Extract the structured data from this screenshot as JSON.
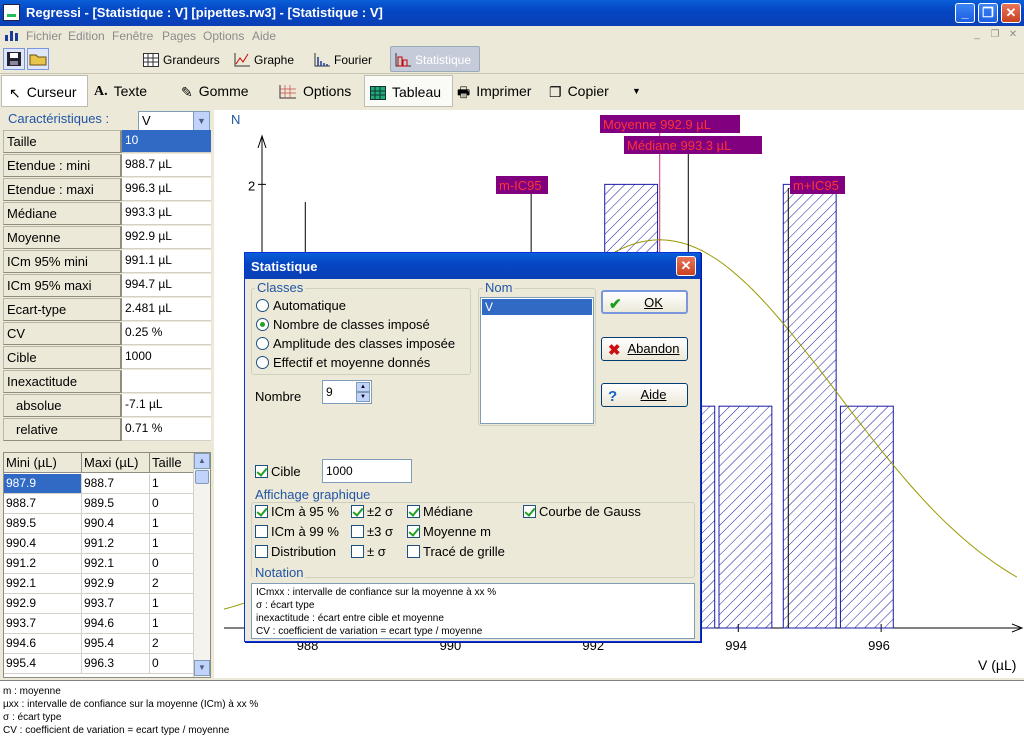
{
  "window": {
    "title": "Regressi  - [Statistique : V] [pipettes.rw3] - [Statistique : V]"
  },
  "menu": {
    "items": [
      "Fichier",
      "Edition",
      "Fenêtre",
      "Pages",
      "Options",
      "Aide"
    ]
  },
  "top_toolbar": {
    "grandeurs": "Grandeurs",
    "graphe": "Graphe",
    "fourier": "Fourier",
    "statistique": "Statistique"
  },
  "tool_toolbar": {
    "curseur": "Curseur",
    "texte": "Texte",
    "gomme": "Gomme",
    "options": "Options",
    "tableau": "Tableau",
    "imprimer": "Imprimer",
    "copier": "Copier"
  },
  "left_panel": {
    "caracteristiques_label": "Caractéristiques :",
    "selected_variable": "V",
    "stats": [
      {
        "key": "Taille",
        "value": "10"
      },
      {
        "key": "Etendue : mini",
        "value": "988.7 µL"
      },
      {
        "key": "Etendue : maxi",
        "value": "996.3 µL"
      },
      {
        "key": "Médiane",
        "value": "993.3 µL"
      },
      {
        "key": "Moyenne",
        "value": "992.9 µL"
      },
      {
        "key": "ICm 95% mini",
        "value": "991.1 µL"
      },
      {
        "key": "ICm 95% maxi",
        "value": "994.7 µL"
      },
      {
        "key": "Ecart-type",
        "value": "2.481 µL"
      },
      {
        "key": "CV",
        "value": " 0.25 %"
      },
      {
        "key": "Cible",
        "value": "1000"
      },
      {
        "key": "Inexactitude",
        "value": ""
      },
      {
        "key": "absolue",
        "value": "-7.1 µL"
      },
      {
        "key": "relative",
        "value": " 0.71 %"
      }
    ],
    "class_table": {
      "headers": [
        "Mini (µL)",
        "Maxi (µL)",
        "Taille"
      ],
      "rows": [
        [
          "987.9",
          "988.7",
          "1"
        ],
        [
          "988.7",
          "989.5",
          "0"
        ],
        [
          "989.5",
          "990.4",
          "1"
        ],
        [
          "990.4",
          "991.2",
          "1"
        ],
        [
          "991.2",
          "992.1",
          "0"
        ],
        [
          "992.1",
          "992.9",
          "2"
        ],
        [
          "992.9",
          "993.7",
          "1"
        ],
        [
          "993.7",
          "994.6",
          "1"
        ],
        [
          "994.6",
          "995.4",
          "2"
        ],
        [
          "995.4",
          "996.3",
          "0"
        ]
      ]
    }
  },
  "graph": {
    "y_label": "N",
    "x_label": "V (µL)",
    "x_ticks": [
      "988",
      "990",
      "992",
      "994",
      "996"
    ],
    "y_ticks": [
      "2",
      "1",
      "0"
    ],
    "annotations": {
      "moyenne": "Moyenne  992.9 µL",
      "mediane": "Médiane  993.3 µL",
      "icm_low": "m-IC95",
      "icm_high": "m+IC95"
    }
  },
  "chart_data": {
    "type": "bar",
    "x": [
      988.3,
      989.1,
      990.0,
      990.8,
      991.6,
      992.5,
      993.3,
      994.1,
      995.0,
      995.8
    ],
    "values": [
      1,
      0,
      1,
      1,
      0,
      2,
      1,
      1,
      2,
      1
    ],
    "xlabel": "V (µL)",
    "ylabel": "N",
    "xlim": [
      986.8,
      998.0
    ],
    "ylim": [
      0,
      2.2
    ],
    "markers": {
      "mean": 992.9,
      "median": 993.3,
      "ic95_low": 991.1,
      "ic95_high": 994.7
    },
    "gauss_curve": {
      "mean": 992.9,
      "sd": 2.481
    }
  },
  "dialog": {
    "title": "Statistique",
    "classes_group": "Classes",
    "radio_options": [
      {
        "label": "Automatique",
        "checked": false
      },
      {
        "label": "Nombre de classes imposé",
        "checked": true
      },
      {
        "label": "Amplitude des classes imposée",
        "checked": false
      },
      {
        "label": "Effectif et moyenne donnés",
        "checked": false
      }
    ],
    "nom_group": "Nom",
    "nom_items": [
      "V"
    ],
    "ok": "OK",
    "abandon": "Abandon",
    "aide": "Aide",
    "nombre_label": "Nombre",
    "nombre_value": "9",
    "cible_label": "Cible",
    "cible_value": "1000",
    "affichage_group": "Affichage graphique",
    "checks": {
      "icm95": {
        "label": "ICm à 95 %",
        "checked": true
      },
      "pm2s": {
        "label": "±2 σ",
        "checked": true
      },
      "mediane": {
        "label": "Médiane",
        "checked": true
      },
      "gauss": {
        "label": "Courbe de Gauss",
        "checked": true
      },
      "icm99": {
        "label": "ICm à 99 %",
        "checked": false
      },
      "pm3s": {
        "label": "±3 σ",
        "checked": false
      },
      "moyenne": {
        "label": "Moyenne m",
        "checked": true
      },
      "distribution": {
        "label": "Distribution",
        "checked": false
      },
      "pms": {
        "label": "± σ",
        "checked": false
      },
      "grille": {
        "label": "Tracé de grille",
        "checked": false
      }
    },
    "notation_group": "Notation",
    "notation_lines": [
      "ICmxx : intervalle de confiance sur la moyenne à xx %",
      "σ : écart type",
      "inexactitude : écart entre cible et moyenne",
      "CV : coefficient de variation  = ecart type / moyenne"
    ]
  },
  "bottom_notes": [
    "m : moyenne",
    "µxx : intervalle de confiance sur la moyenne (ICm) à xx %",
    "σ : écart type",
    "CV : coefficient de variation  = ecart type / moyenne"
  ],
  "colors": {
    "titlebar": "#0a3fb5",
    "annotation_bg": "#800080",
    "annotation_fg": "#ff3333",
    "bar_edge": "#1a1aa6",
    "gauss": "#999900",
    "selection": "#316ac5"
  }
}
